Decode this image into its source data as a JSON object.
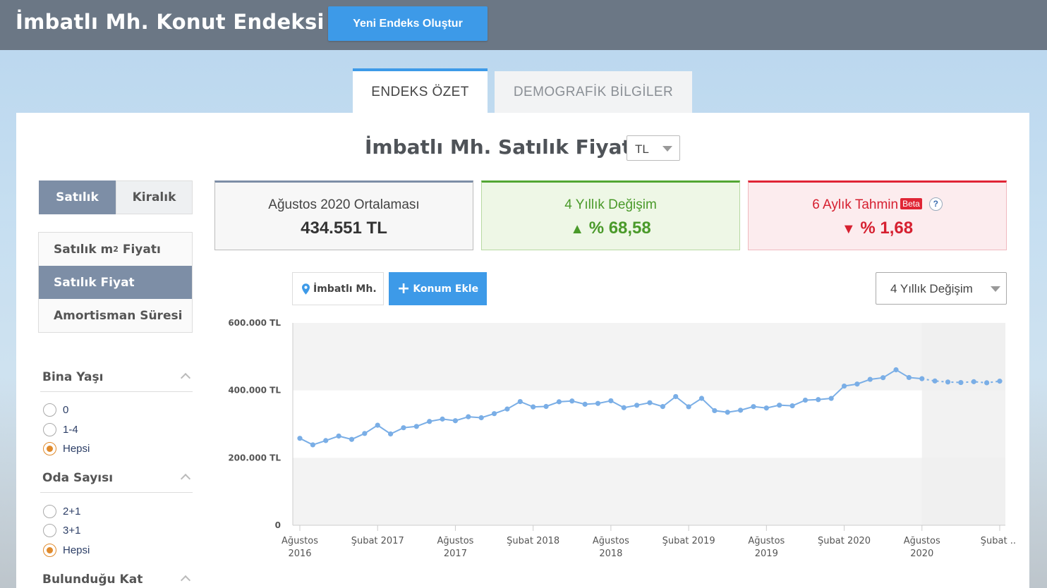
{
  "header": {
    "brand": "İmbatlı Mh. Konut Endeksi",
    "new_index_button": "Yeni Endeks Oluştur"
  },
  "tabs": [
    {
      "label": "ENDEKS ÖZET",
      "active": true
    },
    {
      "label": "DEMOGRAFİK BİLGİLER",
      "active": false
    }
  ],
  "page_title": "İmbatlı Mh. Satılık Fiyat",
  "currency_select": {
    "value": "TL"
  },
  "type_toggle": {
    "sale": "Satılık",
    "rent": "Kiralık",
    "selected": "Satılık"
  },
  "metric_menu": {
    "items": [
      {
        "label": "Satılık m",
        "sup": "2",
        "label_suffix": " Fiyatı"
      },
      {
        "label": "Satılık Fiyat",
        "active": true
      },
      {
        "label": "Amortisman Süresi"
      }
    ]
  },
  "filters": {
    "building_age": {
      "title": "Bina Yaşı",
      "options": [
        "0",
        "1-4",
        "Hepsi"
      ],
      "selected": "Hepsi"
    },
    "room_count": {
      "title": "Oda Sayısı",
      "options": [
        "2+1",
        "3+1",
        "Hepsi"
      ],
      "selected": "Hepsi"
    },
    "floor": {
      "title": "Bulunduğu Kat"
    }
  },
  "cards": {
    "average": {
      "label": "Ağustos 2020 Ortalaması",
      "value": "434.551 TL"
    },
    "change": {
      "label": "4 Yıllık Değişim",
      "arrow": "▲",
      "value": "% 68,58",
      "color": "#4a9a2a"
    },
    "forecast": {
      "label": "6 Aylık Tahmin",
      "badge": "Beta",
      "help": "?",
      "arrow": "▼",
      "value": "% 1,68",
      "color": "#d62030"
    }
  },
  "chart_controls": {
    "location_chip": "İmbatlı Mh.",
    "add_location_button": "Konum Ekle",
    "period_select": "4 Yıllık Değişim"
  },
  "chart_data": {
    "type": "line",
    "series": [
      {
        "name": "İmbatlı Mh."
      }
    ],
    "x_labels": [
      [
        "Ağustos",
        "2016"
      ],
      [
        "Şubat 2017"
      ],
      [
        "Ağustos",
        "2017"
      ],
      [
        "Şubat 2018"
      ],
      [
        "Ağustos",
        "2018"
      ],
      [
        "Şubat 2019"
      ],
      [
        "Ağustos",
        "2019"
      ],
      [
        "Şubat 2020"
      ],
      [
        "Ağustos",
        "2020"
      ],
      [
        "Şubat ..."
      ]
    ],
    "y_ticks": [
      {
        "value": 0,
        "label": "0"
      },
      {
        "value": 200000,
        "label": "200.000 TL"
      },
      {
        "value": 400000,
        "label": "400.000 TL"
      },
      {
        "value": 600000,
        "label": "600.000 TL"
      }
    ],
    "ylim": [
      0,
      600000
    ],
    "start_month": "Ağustos 2016",
    "values": [
      257800,
      238500,
      251100,
      264500,
      254600,
      272200,
      296600,
      270800,
      289200,
      293100,
      307800,
      314900,
      310000,
      321700,
      318800,
      331000,
      344700,
      366700,
      350900,
      352300,
      366100,
      368400,
      358800,
      361200,
      369100,
      348600,
      355800,
      363400,
      352000,
      381600,
      351400,
      376300,
      339900,
      335000,
      341100,
      351900,
      347600,
      356100,
      354200,
      370900,
      372600,
      376200,
      412800,
      418700,
      432600,
      437600,
      461000,
      438100,
      434551
    ],
    "forecast": [
      427800,
      424800,
      423200,
      425700,
      422500,
      427300
    ],
    "shaded_bands": [
      [
        0,
        200000
      ],
      [
        400000,
        600000
      ]
    ],
    "forecast_region_color": "#efefef",
    "line_color": "#7aaee6"
  }
}
